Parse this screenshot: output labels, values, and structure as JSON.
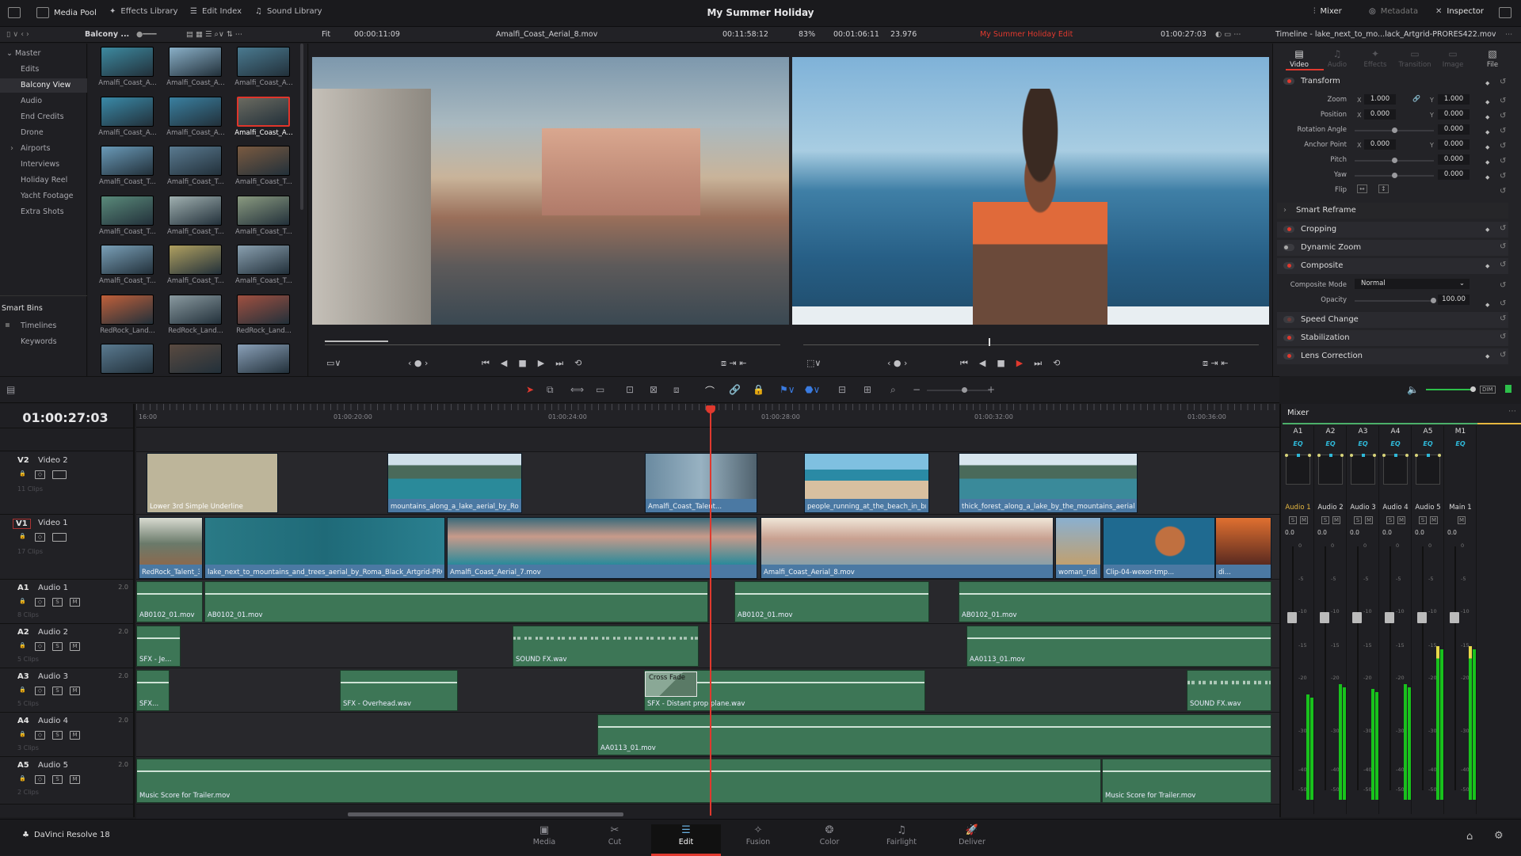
{
  "topbar": {
    "media_pool": "Media Pool",
    "effects_library": "Effects Library",
    "edit_index": "Edit Index",
    "sound_library": "Sound Library",
    "project_title": "My Summer Holiday",
    "mixer": "Mixer",
    "metadata": "Metadata",
    "inspector": "Inspector"
  },
  "toolbar": {
    "bin_name": "Balcony ...",
    "fit": "Fit",
    "source_timecode": "00:00:11:09",
    "source_clip": "Amalfi_Coast_Aerial_8.mov",
    "source_duration": "00:11:58:12",
    "zoom": "83%",
    "timeline_duration": "00:01:06:11",
    "fps": "23.976",
    "timeline_name": "My Summer Holiday Edit",
    "program_timecode": "01:00:27:03",
    "inspector_title": "Timeline - lake_next_to_mo...lack_Artgrid-PRORES422.mov"
  },
  "bins": {
    "master": "Master",
    "items": [
      "Edits",
      "Balcony View",
      "Audio",
      "End Credits",
      "Drone",
      "Airports",
      "Interviews",
      "Holiday Reel",
      "Yacht Footage",
      "Extra Shots"
    ],
    "selected": "Balcony View",
    "smart_bins": "Smart Bins",
    "smart_items": [
      "Timelines",
      "Keywords"
    ]
  },
  "media_clips": [
    "Amalfi_Coast_A...",
    "Amalfi_Coast_A...",
    "Amalfi_Coast_A...",
    "Amalfi_Coast_A...",
    "Amalfi_Coast_A...",
    "Amalfi_Coast_A...",
    "Amalfi_Coast_T...",
    "Amalfi_Coast_T...",
    "Amalfi_Coast_T...",
    "Amalfi_Coast_T...",
    "Amalfi_Coast_T...",
    "Amalfi_Coast_T...",
    "Amalfi_Coast_T...",
    "Amalfi_Coast_T...",
    "Amalfi_Coast_T...",
    "RedRock_Land...",
    "RedRock_Land...",
    "RedRock_Land..."
  ],
  "media_selected_index": 5,
  "inspector": {
    "tabs": [
      "Video",
      "Audio",
      "Effects",
      "Transition",
      "Image",
      "File"
    ],
    "active_tab": "Video",
    "transform": {
      "label": "Transform",
      "zoom_label": "Zoom",
      "zoom_x": "1.000",
      "zoom_y": "1.000",
      "position_label": "Position",
      "position_x": "0.000",
      "position_y": "0.000",
      "rotation_label": "Rotation Angle",
      "rotation": "0.000",
      "anchor_label": "Anchor Point",
      "anchor_x": "0.000",
      "anchor_y": "0.000",
      "pitch_label": "Pitch",
      "pitch": "0.000",
      "yaw_label": "Yaw",
      "yaw": "0.000",
      "flip_label": "Flip",
      "x": "X",
      "y": "Y"
    },
    "smart_reframe": "Smart Reframe",
    "cropping": "Cropping",
    "dynamic_zoom": "Dynamic Zoom",
    "composite": {
      "label": "Composite",
      "mode_label": "Composite Mode",
      "mode": "Normal",
      "opacity_label": "Opacity",
      "opacity": "100.00"
    },
    "speed_change": "Speed Change",
    "stabilization": "Stabilization",
    "lens_correction": "Lens Correction"
  },
  "timeline": {
    "timecode": "01:00:27:03",
    "ruler": [
      "16:00",
      "01:00:20:00",
      "01:00:24:00",
      "01:00:28:00",
      "01:00:32:00",
      "01:00:36:00"
    ],
    "tracks": [
      {
        "code": "V2",
        "name": "Video 2",
        "count": "11 Clips",
        "clips": [
          "Lower 3rd Simple Underline",
          "mountains_along_a_lake_aerial_by_Roma...",
          "Amalfi_Coast_Talent...",
          "people_running_at_the_beach_in_brig...",
          "thick_forest_along_a_lake_by_the_mountains_aerial_by_..."
        ]
      },
      {
        "code": "V1",
        "name": "Video 1",
        "count": "17 Clips",
        "clips": [
          "RedRock_Talent_3...",
          "lake_next_to_mountains_and_trees_aerial_by_Roma_Black_Artgrid-PRORES4...",
          "Amalfi_Coast_Aerial_7.mov",
          "Amalfi_Coast_Aerial_8.mov",
          "woman_ridi...",
          "Clip-04-wexor-tmp...",
          "di..."
        ]
      },
      {
        "code": "A1",
        "name": "Audio 1",
        "channels": "2.0",
        "count": "8 Clips",
        "clips": [
          "AB0102_01.mov",
          "AB0102_01.mov",
          "AB0102_01.mov",
          "AB0102_01.mov"
        ]
      },
      {
        "code": "A2",
        "name": "Audio 2",
        "channels": "2.0",
        "count": "5 Clips",
        "clips": [
          "SFX - Je...",
          "SOUND FX.wav",
          "AA0113_01.mov"
        ]
      },
      {
        "code": "A3",
        "name": "Audio 3",
        "channels": "2.0",
        "count": "5 Clips",
        "clips": [
          "SFX...",
          "SFX - Overhead.wav",
          "SFX - Distant prop plane.wav",
          "SOUND FX.wav"
        ],
        "transition": "Cross Fade"
      },
      {
        "code": "A4",
        "name": "Audio 4",
        "channels": "2.0",
        "count": "3 Clips",
        "clips": [
          "AA0113_01.mov"
        ]
      },
      {
        "code": "A5",
        "name": "Audio 5",
        "channels": "2.0",
        "count": "2 Clips",
        "clips": [
          "Music Score for Trailer.mov",
          "Music Score for Trailer.mov"
        ]
      }
    ]
  },
  "mixer": {
    "title": "Mixer",
    "eq": "EQ",
    "scale": [
      "0",
      "-5",
      "-10",
      "-15",
      "-20",
      "-30",
      "-40",
      "-50"
    ],
    "channels": [
      {
        "id": "A1",
        "name": "Audio 1",
        "value": "0.0",
        "meter_db": -23,
        "solo": "S",
        "mute": "M"
      },
      {
        "id": "A2",
        "name": "Audio 2",
        "value": "0.0",
        "meter_db": -21,
        "solo": "S",
        "mute": "M"
      },
      {
        "id": "A3",
        "name": "Audio 3",
        "value": "0.0",
        "meter_db": -22,
        "solo": "S",
        "mute": "M"
      },
      {
        "id": "A4",
        "name": "Audio 4",
        "value": "0.0",
        "meter_db": -21,
        "solo": "S",
        "mute": "M"
      },
      {
        "id": "A5",
        "name": "Audio 5",
        "value": "0.0",
        "meter_db": -15,
        "solo": "S",
        "mute": "M"
      },
      {
        "id": "M1",
        "name": "Main 1",
        "value": "0.0",
        "meter_db": -15,
        "mute": "M"
      }
    ],
    "colors": {
      "meter": "#18c21c",
      "peak": "#e8d84a",
      "active": "#e6b740"
    }
  },
  "pages": {
    "app": "DaVinci Resolve 18",
    "items": [
      "Media",
      "Cut",
      "Edit",
      "Fusion",
      "Color",
      "Fairlight",
      "Deliver"
    ],
    "active": "Edit"
  },
  "colors": {
    "accent": "#e0392e",
    "video_clip": "#4b79a3",
    "audio_clip": "#3d7656",
    "title_clip": "#bdb59a"
  }
}
